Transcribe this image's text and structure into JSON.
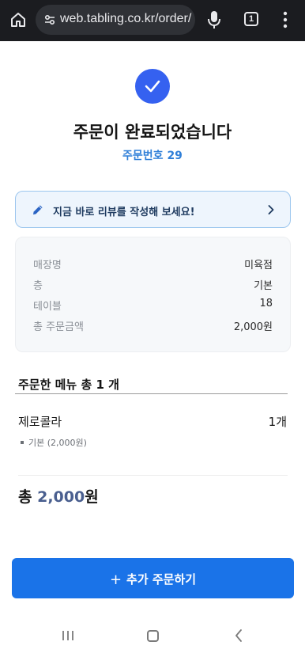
{
  "browser": {
    "url": "web.tabling.co.kr/order/",
    "tab_count": "1"
  },
  "header": {
    "title": "주문이 완료되었습니다",
    "order_number": "주문번호 29"
  },
  "review_banner": {
    "text": "지금 바로 리뷰를 작성해 보세요!"
  },
  "info": {
    "rows": [
      {
        "label": "매장명",
        "value": "미육점"
      },
      {
        "label": "층",
        "value": "기본"
      },
      {
        "label": "테이블",
        "value": "18"
      },
      {
        "label": "총 주문금액",
        "value": "2,000원"
      }
    ]
  },
  "menu": {
    "heading": "주문한 메뉴 총 1 개",
    "items": [
      {
        "name": "제로콜라",
        "qty": "1개",
        "option": "기본 (2,000원)"
      }
    ]
  },
  "total": {
    "prefix": "총 ",
    "amount": "2,000",
    "suffix": "원"
  },
  "action": {
    "plus": "+",
    "label": "추가 주문하기"
  },
  "colors": {
    "accent": "#3561f0",
    "button": "#1a73e8",
    "order_number": "#2f7fd8",
    "total_amount": "#4a5f8f"
  },
  "icons": [
    "home-icon",
    "site-settings-icon",
    "mic-icon",
    "tab-switcher-icon",
    "more-vert-icon",
    "check-icon",
    "pencil-icon",
    "chevron-right-icon",
    "recent-apps-icon",
    "home-nav-icon",
    "back-icon"
  ]
}
